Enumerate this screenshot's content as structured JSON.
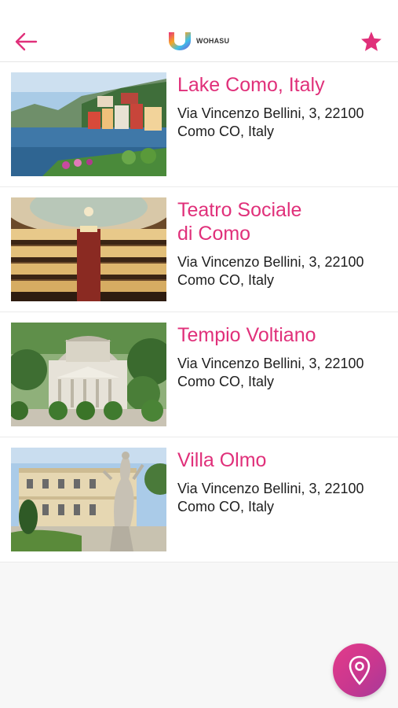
{
  "header": {
    "back_icon": "arrow-left-icon",
    "logo_text": "WOHASU",
    "favorites_icon": "star-icon",
    "accent_color": "#e0307a"
  },
  "places": [
    {
      "title": "Lake Como, Italy",
      "address": "Via Vincenzo Bellini, 3, 22100 Como CO, Italy",
      "image": "lake-village-photo"
    },
    {
      "title": "Teatro Sociale di Como",
      "address": "Via Vincenzo Bellini, 3, 22100 Como CO, Italy",
      "image": "theatre-interior-photo"
    },
    {
      "title": "Tempio Voltiano",
      "address": "Via Vincenzo Bellini, 3, 22100 Como CO, Italy",
      "image": "domed-temple-photo"
    },
    {
      "title": "Villa Olmo",
      "address": "Via Vincenzo Bellini, 3, 22100 Como CO, Italy",
      "image": "villa-statue-photo"
    }
  ],
  "fab": {
    "icon": "map-pin-icon"
  }
}
